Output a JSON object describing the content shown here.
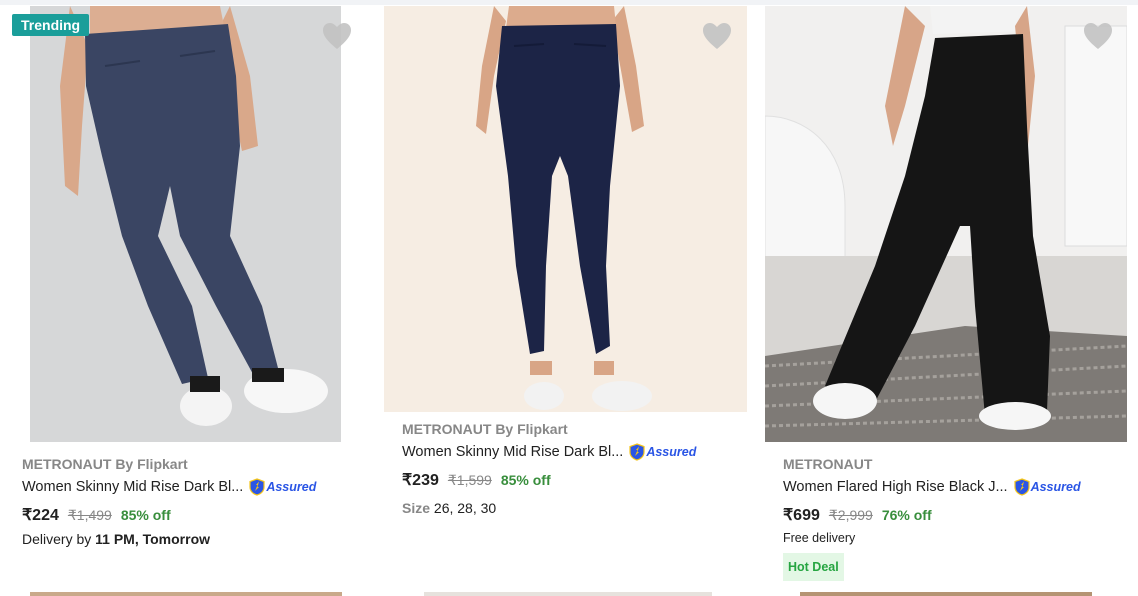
{
  "colors": {
    "offer_green": "#388e3c",
    "assured_blue": "#2a55e5",
    "trending_teal": "#1a9e9a",
    "hot_deal_bg": "#e3f7e5",
    "hot_deal_text": "#26a541"
  },
  "products": [
    {
      "badge": "Trending",
      "brand": "METRONAUT By Flipkart",
      "title": "Women Skinny Mid Rise Dark Bl...",
      "assured": "Assured",
      "price": "₹224",
      "mrp": "₹1,499",
      "discount": "85% off",
      "delivery_prefix": "Delivery by ",
      "delivery_time": "11 PM, Tomorrow",
      "icons": [
        "heart-icon",
        "assured-shield-icon"
      ]
    },
    {
      "brand": "METRONAUT By Flipkart",
      "title": "Women Skinny Mid Rise Dark Bl...",
      "assured": "Assured",
      "price": "₹239",
      "mrp": "₹1,599",
      "discount": "85% off",
      "size_label": "Size",
      "sizes": "26, 28, 30",
      "icons": [
        "heart-icon",
        "assured-shield-icon"
      ]
    },
    {
      "brand": "METRONAUT",
      "title": "Women Flared High Rise Black J...",
      "assured": "Assured",
      "price": "₹699",
      "mrp": "₹2,999",
      "discount": "76% off",
      "delivery": "Free delivery",
      "tag": "Hot Deal",
      "icons": [
        "heart-icon",
        "assured-shield-icon"
      ]
    }
  ]
}
